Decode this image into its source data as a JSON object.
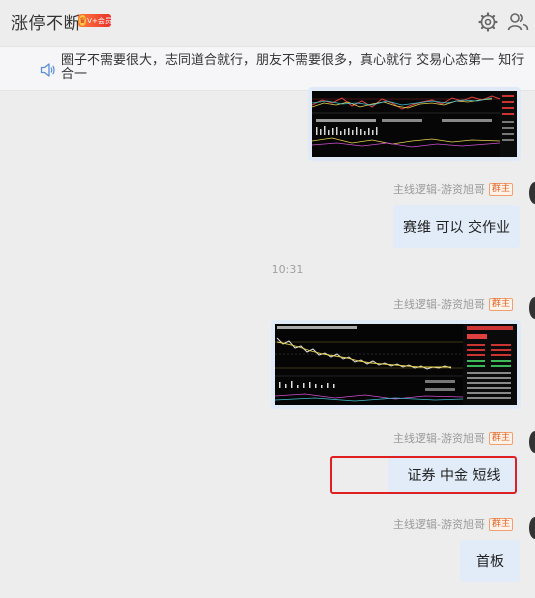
{
  "header": {
    "title": "涨停不断",
    "vip_badge": "V+会员",
    "settings_icon": "gear-icon",
    "members_icon": "group-members-icon"
  },
  "notice": {
    "icon": "speaker-icon",
    "text": "圈子不需要很大，志同道合就行，朋友不需要很多，真心就行 交易心态第一 知行合一"
  },
  "messages": {
    "sender_name": "主线逻辑-游资旭哥",
    "owner_badge": "群主",
    "msg1_text": "赛维  可以 交作业",
    "timestamp": "10:31",
    "msg3_text": "证券  中金   短线",
    "msg4_text": "首板"
  },
  "colors": {
    "bubble": "#e1ecf8",
    "highlight": "#e02020",
    "owner_badge": "#e0662a"
  }
}
